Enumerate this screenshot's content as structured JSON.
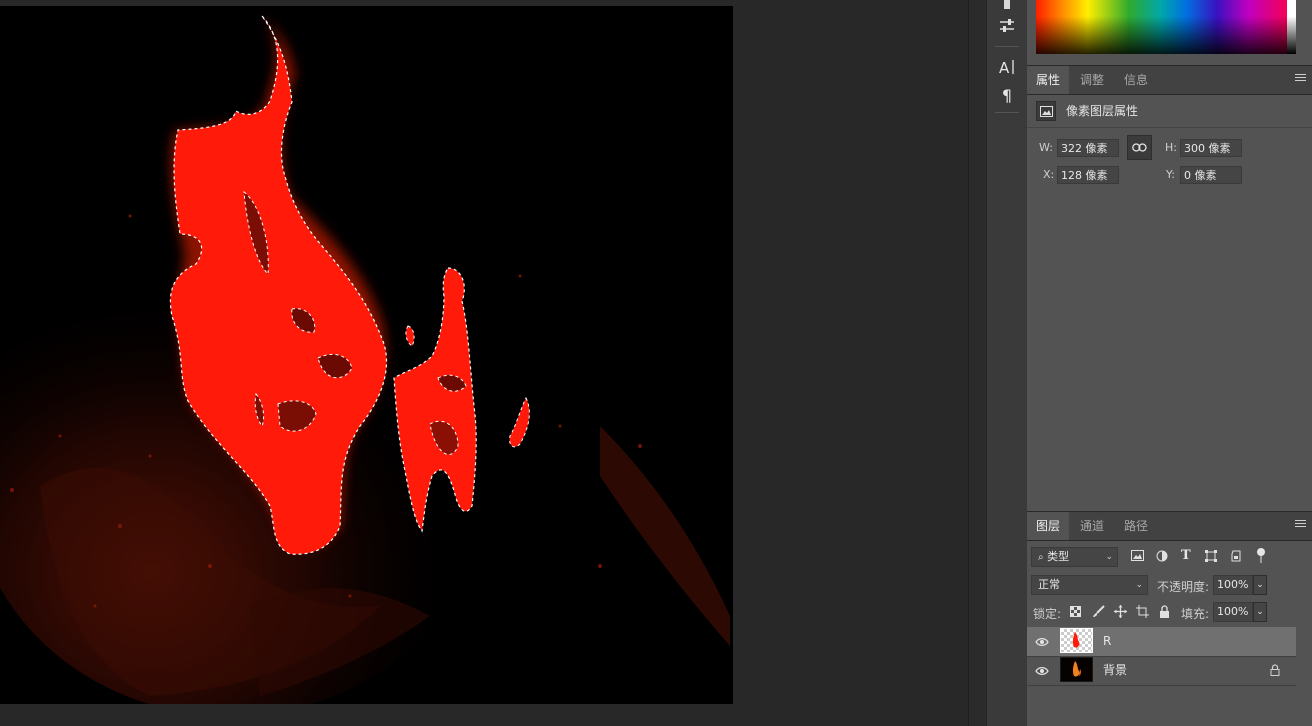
{
  "properties_panel": {
    "tabs": [
      {
        "label": "属性",
        "active": true
      },
      {
        "label": "调整",
        "active": false
      },
      {
        "label": "信息",
        "active": false
      }
    ],
    "header_title": "像素图层属性",
    "w_label": "W:",
    "w_value": "322 像素",
    "h_label": "H:",
    "h_value": "300 像素",
    "x_label": "X:",
    "x_value": "128 像素",
    "y_label": "Y:",
    "y_value": "0 像素"
  },
  "layers_panel": {
    "tabs": [
      {
        "label": "图层",
        "active": true
      },
      {
        "label": "通道",
        "active": false
      },
      {
        "label": "路径",
        "active": false
      }
    ],
    "filter_kind": "类型",
    "blend_mode": "正常",
    "opacity_label": "不透明度:",
    "opacity_value": "100%",
    "lock_label": "锁定:",
    "fill_label": "填充:",
    "fill_value": "100%",
    "layers": [
      {
        "name": "R",
        "selected": true,
        "locked": false
      },
      {
        "name": "背景",
        "selected": false,
        "locked": true
      }
    ]
  },
  "icons": {
    "adjustments": "sliders-icon",
    "character": "text-char-icon",
    "paragraph": "pilcrow-icon",
    "link": "link-icon",
    "lock": "lock-icon"
  },
  "colors": {
    "selection_red": "#ff1a0a",
    "panel_bg": "#535353",
    "workspace_bg": "#282828"
  }
}
